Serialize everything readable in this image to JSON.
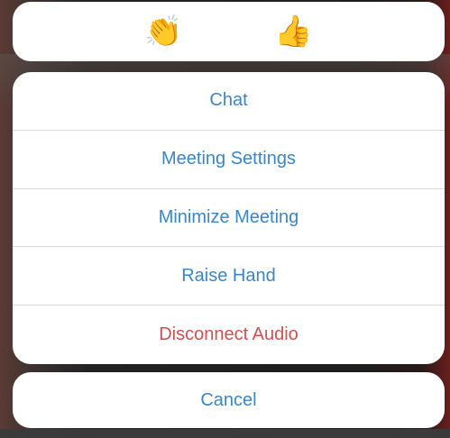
{
  "reactions": {
    "items": [
      {
        "name": "clap",
        "glyph": "👏"
      },
      {
        "name": "thumbs-up",
        "glyph": "👍"
      }
    ]
  },
  "menu": {
    "items": [
      {
        "label": "Chat"
      },
      {
        "label": "Meeting Settings"
      },
      {
        "label": "Minimize Meeting"
      },
      {
        "label": "Raise Hand"
      },
      {
        "label": "Disconnect Audio"
      }
    ],
    "accent_color": "#3a86c8",
    "destructive_color": "#d0504f"
  },
  "cancel": {
    "label": "Cancel"
  }
}
